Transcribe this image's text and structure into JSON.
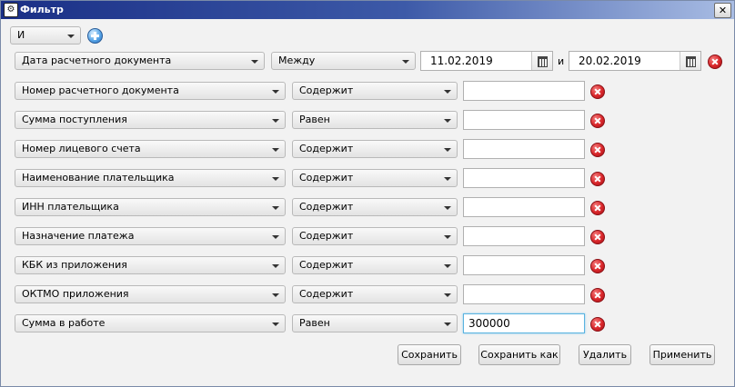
{
  "window": {
    "title": "Фильтр",
    "close_glyph": "✕",
    "app_icon": "⚙"
  },
  "logic": {
    "value": "И",
    "add_icon": "add-circle-icon"
  },
  "date_row": {
    "field": "Дата расчетного документа",
    "operator": "Между",
    "from": "11.02.2019",
    "and_label": "и",
    "to": "20.02.2019"
  },
  "rows": [
    {
      "field": "Номер расчетного документа",
      "operator": "Содержит",
      "value": ""
    },
    {
      "field": "Сумма поступления",
      "operator": "Равен",
      "value": ""
    },
    {
      "field": "Номер лицевого счета",
      "operator": "Содержит",
      "value": ""
    },
    {
      "field": "Наименование плательщика",
      "operator": "Содержит",
      "value": ""
    },
    {
      "field": "ИНН плательщика",
      "operator": "Содержит",
      "value": ""
    },
    {
      "field": "Назначение платежа",
      "operator": "Содержит",
      "value": ""
    },
    {
      "field": "КБК из приложения",
      "operator": "Содержит",
      "value": ""
    },
    {
      "field": "ОКТМО приложения",
      "operator": "Содержит",
      "value": ""
    },
    {
      "field": "Сумма в работе",
      "operator": "Равен",
      "value": "300000"
    }
  ],
  "buttons": {
    "save": "Сохранить",
    "save_as": "Сохранить как",
    "delete": "Удалить",
    "apply": "Применить"
  },
  "colors": {
    "titlebar": "#1a2f86",
    "remove": "#d9262a",
    "add": "#5aa7e8",
    "focus": "#5ab3e0"
  }
}
